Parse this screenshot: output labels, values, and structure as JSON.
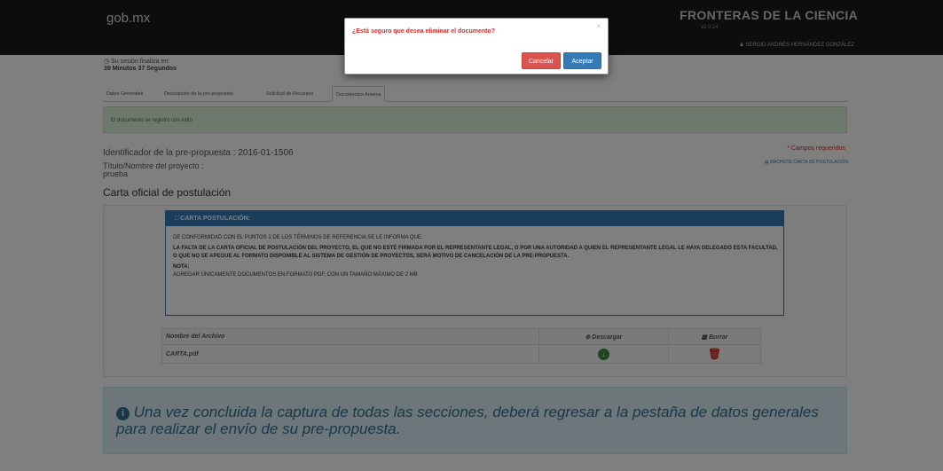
{
  "header": {
    "brand": "gob.mx",
    "app_title": "FRONTERAS DE LA CIENCIA",
    "version": "v2.0.14",
    "user_name": "SERGIO ANDRÉS HERNÁNDEZ GONZÁLEZ",
    "user_icon": "user-icon"
  },
  "session": {
    "label": "Su sesión finaliza en:",
    "remaining": "39 Minutos 37 Segundos",
    "icon": "clock-icon"
  },
  "tabs": [
    {
      "label": "Datos Generales"
    },
    {
      "label": "Descripción de la pre-propuesta"
    },
    {
      "label": "Solicitud de Recursos"
    },
    {
      "label": "Documentos Anexos",
      "active": true
    }
  ],
  "alert": {
    "message": "El documento se registró con éxito"
  },
  "form": {
    "identifier_label": "Identificador de la pre-propuesta :",
    "identifier_value": "2016-01-1506",
    "title_label": "Título/Nombre del proyecto :",
    "title_value": "prueba",
    "required_note": "* Campos requeridos",
    "machote_link": "MACHOTE CARTA DE POSTULACIÓN",
    "section_title": "Carta oficial de postulación"
  },
  "panel": {
    "header": "CARTA POSTULACIÓN:",
    "header_icon": "document-icon",
    "intro": "DE CONFORMIDAD CON EL PUNTOS 1 DE LOS TÉRMINOS DE REFERENCIA SE LE INFORMA QUE:",
    "body": "LA FALTA DE LA CARTA OFICIAL DE POSTULACIÓN DEL PROYECTO, EL QUE NO ESTÉ FIRMADA POR EL REPRESENTANTE LEGAL, O POR UNA AUTORIDAD A QUIEN EL REPRESENTANTE LEGAL LE HAYA DELEGADO ESTA FACULTAD, O QUE NO SE APEGUE AL FORMATO DISPONIBLE AL SISTEMA DE GESTIÓN DE PROYECTOS, SERÁ MOTIVO DE CANCELACIÓN DE LA PRE-PROPUESTA.",
    "note_label": "NOTA:",
    "note_text": "AGREGAR ÚNICAMENTE DOCUMENTOS EN FORMATO PDF, CON UN TAMAÑO MÁXIMO DE 2 MB"
  },
  "file_table": {
    "col_name": "Nombre del Archivo",
    "col_download": "Descargar",
    "col_delete": "Borrar",
    "rows": [
      {
        "name": "CARTA.pdf"
      }
    ]
  },
  "info": {
    "message": "Una vez concluida la captura de todas las secciones, deberá regresar a la pestaña de datos generales para realizar el envío de su pre-propuesta.",
    "icon": "info-icon"
  },
  "modal": {
    "title": "¿Está seguro que desea eliminar el documento?",
    "close": "×",
    "cancel_label": "Cancelar",
    "ok_label": "Aceptar"
  },
  "colors": {
    "danger": "#d9534f",
    "primary": "#337ab7",
    "success_bg": "#dff0d8",
    "info_bg": "#d9edf7"
  }
}
